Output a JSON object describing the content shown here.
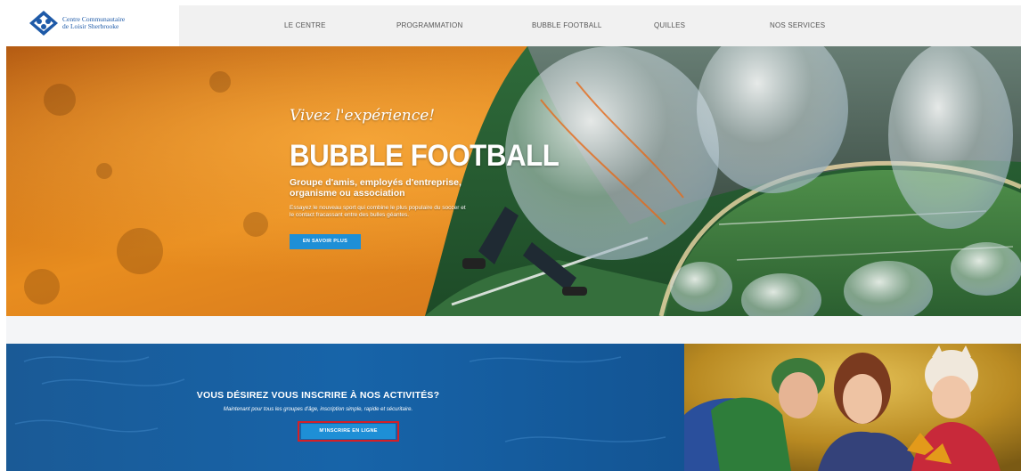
{
  "header": {
    "logo": {
      "line1": "Centre Communautaire",
      "line2": "de Loisir Sherbrooke",
      "icon": "logo-diamond-icon"
    },
    "nav": [
      {
        "label": "LE CENTRE"
      },
      {
        "label": "PROGRAMMATION"
      },
      {
        "label": "BUBBLE FOOTBALL"
      },
      {
        "label": "QUILLES"
      },
      {
        "label": "NOS SERVICES"
      }
    ]
  },
  "hero": {
    "tagline": "Vivez l'expérience!",
    "title": "BUBBLE FOOTBALL",
    "subtitle": "Groupe d'amis, employés d'entreprise, organisme ou association",
    "description": "Essayez le nouveau sport qui combine le plus populaire du soccer et le contact fracassant entre des bulles géantes.",
    "button": "EN SAVOIR PLUS"
  },
  "signup": {
    "title": "VOUS DÉSIREZ VOUS INSCRIRE À NOS ACTIVITÉS?",
    "subtitle": "Maintenant pour tous les groupes d'âge, inscription simple, rapide et sécuritaire.",
    "button": "M'INSCRIRE EN LIGNE"
  },
  "colors": {
    "brand_blue": "#1e5aa8",
    "button_blue": "#1e8fd6",
    "highlight_red": "#d42027",
    "hero_orange": "#d9801a",
    "band_blue": "#1764a9"
  }
}
